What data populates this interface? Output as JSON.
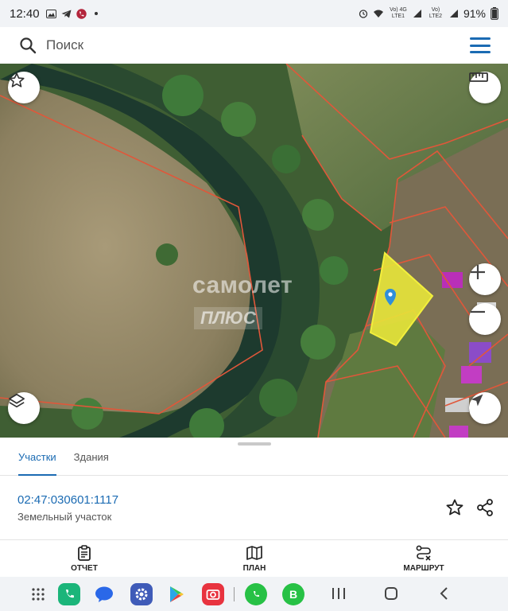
{
  "status_bar": {
    "time": "12:40",
    "battery": "91%",
    "sim1": "Vo) 4G LTE1",
    "sim2": "Vo) LTE2",
    "icons": [
      "gallery-icon",
      "telegram-icon",
      "phone-call-icon",
      "dot-icon",
      "alarm-icon",
      "wifi-icon",
      "signal-icon",
      "battery-icon"
    ]
  },
  "search": {
    "placeholder": "Поиск",
    "icon": "search-icon",
    "menu_icon": "hamburger-menu-icon"
  },
  "map": {
    "watermark_line1": "самолет",
    "watermark_line2": "ПЛЮС",
    "controls": [
      "favorite-star-icon",
      "ruler-icon",
      "zoom-in-icon",
      "zoom-out-icon",
      "layers-icon",
      "locate-arrow-icon"
    ],
    "highlight_color": "#e8e63a",
    "parcel_border_color": "#e0573a",
    "pin_color": "#2f8fd8"
  },
  "sheet": {
    "tabs": [
      {
        "label": "Участки",
        "active": true
      },
      {
        "label": "Здания",
        "active": false
      }
    ],
    "cadastral_number": "02:47:030601:1117",
    "parcel_type": "Земельный участок",
    "actions": [
      {
        "label": "ОТЧЕТ",
        "icon": "report-clipboard-icon"
      },
      {
        "label": "ПЛАН",
        "icon": "map-plan-icon"
      },
      {
        "label": "МАРШРУТ",
        "icon": "route-icon"
      }
    ],
    "accent_color": "#1b6bb3"
  },
  "nav_bar": {
    "apps": [
      "app-drawer-icon",
      "phone-app-icon",
      "messages-app-icon",
      "settings-app-icon",
      "play-store-icon",
      "camera-app-icon",
      "whatsapp-icon",
      "whatsapp-business-icon"
    ],
    "buttons": [
      "recents-button",
      "home-button",
      "back-button"
    ]
  }
}
